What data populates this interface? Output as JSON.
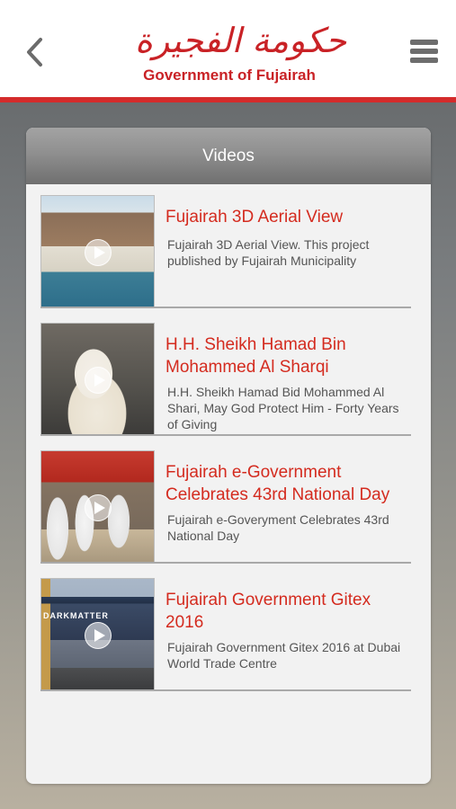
{
  "header": {
    "logo_arabic": "حكومة الفجيرة",
    "logo_english": "Government of Fujairah",
    "accent_color": "#d42b2b"
  },
  "panel": {
    "title": "Videos"
  },
  "videos": [
    {
      "title": "Fujairah 3D Aerial View",
      "description": "Fujairah 3D Aerial View. This project published by Fujairah Municipality"
    },
    {
      "title": "H.H. Sheikh Hamad Bin Mohammed Al Sharqi",
      "description": "H.H. Sheikh Hamad Bid Mohammed Al Shari, May God Protect Him - Forty Years of Giving"
    },
    {
      "title": "Fujairah e-Government Celebrates 43rd National Day",
      "description": "Fujairah e-Goveryment Celebrates 43rd National Day"
    },
    {
      "title": "Fujairah Government Gitex 2016",
      "description": "Fujairah Government Gitex 2016 at Dubai World Trade Centre",
      "thumbnail_text": "DARKMATTER"
    }
  ],
  "icons": {
    "back": "chevron-left-icon",
    "menu": "hamburger-menu-icon",
    "play": "play-icon"
  }
}
